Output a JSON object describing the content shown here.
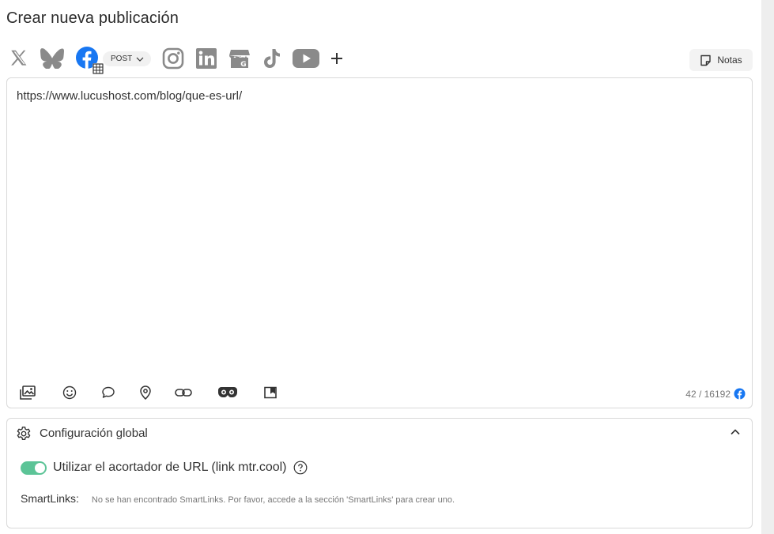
{
  "page": {
    "title": "Crear nueva publicación"
  },
  "networks": [
    {
      "name": "x-icon"
    },
    {
      "name": "bluesky-icon"
    },
    {
      "name": "facebook-icon",
      "color": "#1877f2"
    },
    {
      "name": "instagram-icon"
    },
    {
      "name": "linkedin-icon"
    },
    {
      "name": "google-business-icon"
    },
    {
      "name": "tiktok-icon"
    },
    {
      "name": "youtube-icon"
    },
    {
      "name": "plus-icon"
    }
  ],
  "post_type": {
    "label": "POST"
  },
  "notes_button": {
    "label": "Notas"
  },
  "editor": {
    "content": "https://www.lucushost.com/blog/que-es-url/",
    "toolbar_icons": [
      "media-icon",
      "emoji-icon",
      "comment-icon",
      "location-icon",
      "link-icon",
      "ai-assistant-icon",
      "bookmark-icon"
    ],
    "counter": "42 / 16192"
  },
  "global_config": {
    "title": "Configuración global",
    "url_shortener": {
      "label": "Utilizar el acortador de URL (link mtr.cool)",
      "enabled": true
    },
    "smartlinks": {
      "label": "SmartLinks:",
      "message": "No se han encontrado SmartLinks. Por favor, accede a la sección 'SmartLinks' para crear uno."
    }
  },
  "colors": {
    "accent_green": "#5cc497",
    "facebook_blue": "#1877f2",
    "icon_gray": "#888888"
  }
}
